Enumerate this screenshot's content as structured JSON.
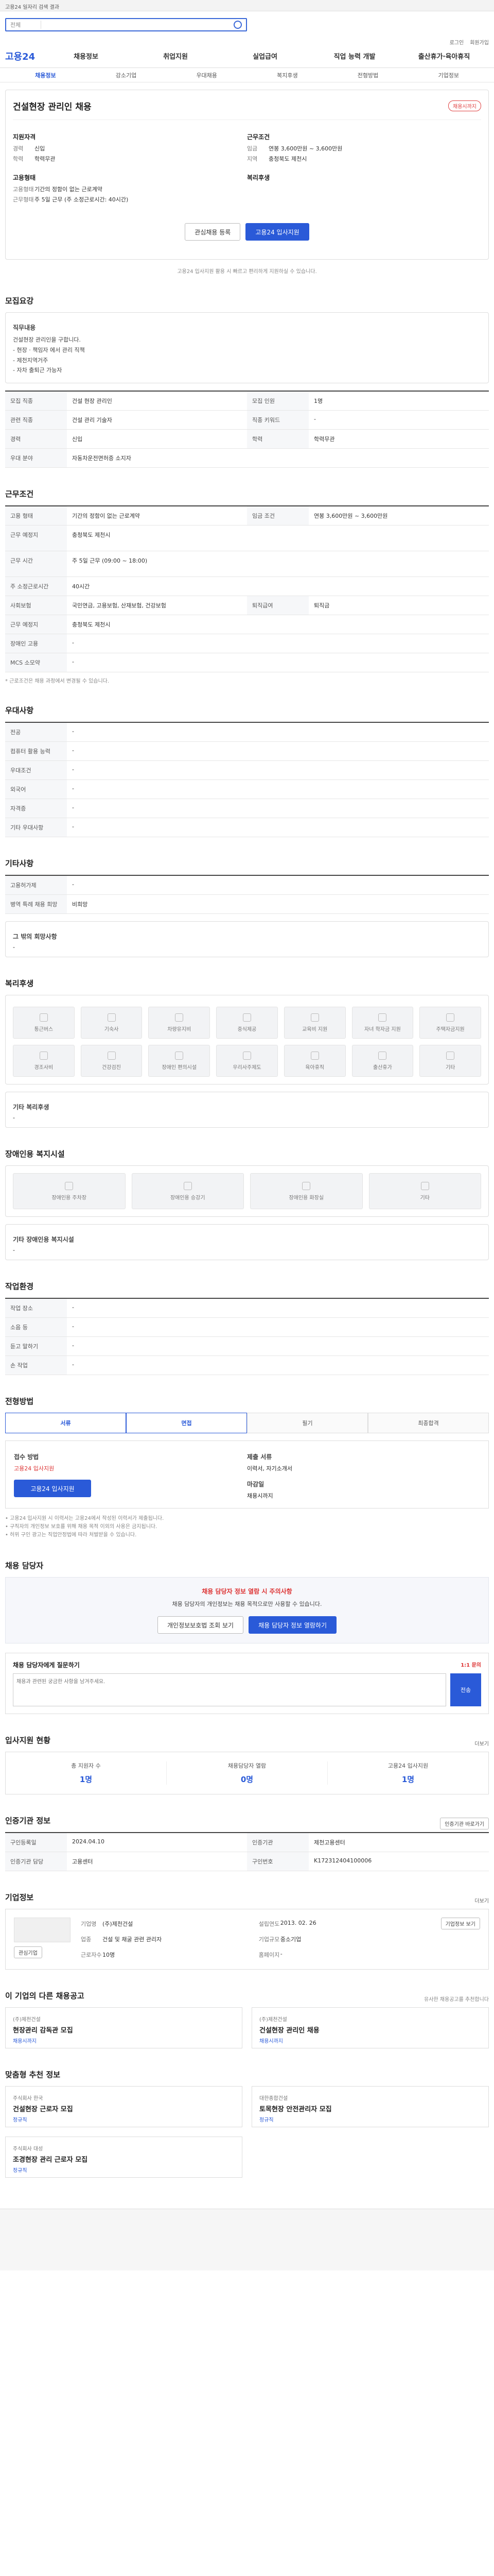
{
  "topbar": {
    "text": "고용24 일자리 검색 결과"
  },
  "search": {
    "category": "전체",
    "placeholder": ""
  },
  "util": [
    "로그인",
    "회원가입"
  ],
  "logo": "고용24",
  "gnb": [
    "채용정보",
    "취업지원",
    "실업급여",
    "직업 능력 개발",
    "출산휴가·육아휴직"
  ],
  "lnb": [
    "채용정보",
    "강소기업",
    "우대채용",
    "복지후생",
    "전형방법",
    "기업정보"
  ],
  "job": {
    "title": "건설현장 관리인 채용",
    "badge": "채용시까지",
    "left_title": "지원자격",
    "left_rows": [
      {
        "k": "경력",
        "v": "신입"
      },
      {
        "k": "학력",
        "v": "학력무관"
      }
    ],
    "left_title2": "고용형태",
    "left_rows2": [
      {
        "k": "고용형태",
        "v": "기간의 정함이 없는 근로계약"
      },
      {
        "k": "근무형태",
        "v": "주 5일 근무 (주 소정근로시간: 40시간)"
      }
    ],
    "right_title": "근무조건",
    "right_rows": [
      {
        "k": "임금",
        "v": "연봉 3,600만원 ~ 3,600만원"
      },
      {
        "k": "지역",
        "v": "충청북도 제천시"
      }
    ],
    "right_title2": "복리후생",
    "btn_scrap": "관심채용 등록",
    "btn_apply": "고용24 입사지원",
    "notice": "고용24 입사지원 활용 시 빠르고 편리하게 지원하실 수 있습니다."
  },
  "s_detail": {
    "title": "모집요강",
    "sub": "직무내용",
    "desc_lines": [
      "건설현장 관리인을 구합니다.",
      "- 현장 · 책임자 에서 관리 직책",
      "- 제천지역거주",
      "- 자차 출퇴근 가능자"
    ],
    "rows": [
      {
        "th": "모집 직종",
        "td": "건설 현장 관리인"
      },
      {
        "th": "모집 인원",
        "td": "1명"
      },
      {
        "th": "관련 직종",
        "td": "건설 관리 기술자"
      },
      {
        "th": "직종 키워드",
        "td": "-"
      },
      {
        "th": "경력",
        "td": "신입"
      },
      {
        "th": "학력",
        "td": "학력무관"
      },
      {
        "th": "우대 분야",
        "td": "자동차운전면허증 소지자"
      }
    ]
  },
  "s_cond": {
    "title": "근무조건",
    "rows": [
      {
        "th": "고용 형태",
        "td": "기간의 정함이 없는 근로계약"
      },
      {
        "th": "임금 조건",
        "td": "연봉 3,600만원 ~ 3,600만원"
      },
      {
        "th": "근무 예정지",
        "td": "충청북도 제천시"
      },
      {
        "th": "근무 시간",
        "td": "주 5일 근무 (09:00 ~ 18:00)"
      },
      {
        "th": "주 소정근로시간",
        "td": "40시간"
      },
      {
        "th": "사회보험",
        "td": "국민연금, 고용보험, 산재보험, 건강보험"
      },
      {
        "th": "퇴직급여",
        "td": "퇴직금"
      },
      {
        "th": "근무 예정지",
        "td": "충청북도 제천시"
      },
      {
        "th": "장애인 고용",
        "td": "-"
      },
      {
        "th": "MCS 소모약",
        "td": "-"
      }
    ],
    "note": "* 근로조건은 채용 과정에서 변경될 수 있습니다."
  },
  "s_pref": {
    "title": "우대사항",
    "rows": [
      {
        "th": "전공",
        "td": "-"
      },
      {
        "th": "컴퓨터 활용 능력",
        "td": "-"
      },
      {
        "th": "우대조건",
        "td": "-"
      },
      {
        "th": "외국어",
        "td": "-"
      },
      {
        "th": "자격증",
        "td": "-"
      },
      {
        "th": "기타 우대사항",
        "td": "-"
      }
    ]
  },
  "s_etc": {
    "title": "기타사항",
    "rows": [
      {
        "th": "고용허가제",
        "td": "-"
      },
      {
        "th": "병역 특례 채용 희망",
        "td": "비희망"
      }
    ],
    "sub": "그 밖의 회망사항",
    "sub_val": "-"
  },
  "s_welfare": {
    "title": "복리후생",
    "items": [
      "통근버스",
      "기숙사",
      "차량유지비",
      "중식제공",
      "교육비 지원",
      "자녀 학자금 지원",
      "주택자금지원",
      "경조사비",
      "건강검진",
      "장애인 편의시설",
      "우리사주제도",
      "육아휴직",
      "출산휴가",
      "기타"
    ],
    "sub": "기타 복리후생",
    "sub_val": "-"
  },
  "s_disabled": {
    "title": "장애인용 복지시설",
    "items": [
      "장애인용 주차장",
      "장애인용 승강기",
      "장애인용 화장실",
      "기타"
    ],
    "sub": "기타 장애인용 복지시설",
    "sub_val": "-"
  },
  "s_work": {
    "title": "작업환경",
    "rows": [
      {
        "th": "작업 장소",
        "td": "-"
      },
      {
        "th": "소음 등",
        "td": "-"
      },
      {
        "th": "듣고 말하기",
        "td": "-"
      },
      {
        "th": "손 작업",
        "td": "-"
      }
    ]
  },
  "s_process": {
    "title": "전형방법",
    "steps": [
      "서류",
      "면접",
      "필기",
      "최종합격"
    ],
    "apply_title": "접수 방법",
    "apply_val": "고용24 입사지원",
    "apply_btn": "고용24 입사지원",
    "docs_title": "제출 서류",
    "docs_val": "이력서, 자기소개서",
    "date_title": "마감일",
    "date_val": "채용시까지",
    "warn": [
      "고용24 입사지원 시 이력서는 고용24에서 작성된 이력서가 제출됩니다.",
      "구직자의 개인정보 보호를 위해 채용 목적 이외의 사용은 금지됩니다.",
      "허위 구인 광고는 직업안정법에 따라 처벌받을 수 있습니다."
    ]
  },
  "s_contact": {
    "title": "채용 담당자",
    "alert_hd": "채용 담당자 정보 열람 시 주의사항",
    "alert_body": "채용 담당자의 개인정보는 채용 목적으로만 사용할 수 있습니다.",
    "btn_agree": "개인정보보호법 조회 보기",
    "btn_view": "채용 담당자 정보 열람하기",
    "qa_title": "채용 담당자에게 질문하기",
    "qa_note": "1:1 문의",
    "qa_placeholder": "채용과 관련된 궁금한 사항을 남겨주세요.",
    "qa_send": "전송"
  },
  "s_stats": {
    "title": "입사지원 현황",
    "link": "더보기",
    "items": [
      {
        "label": "총 지원자 수",
        "num": "1명"
      },
      {
        "label": "채용담당자 열람",
        "num": "0명"
      },
      {
        "label": "고용24 입사지원",
        "num": "1명"
      }
    ]
  },
  "s_info": {
    "title": "인증기관 정보",
    "btn": "인증기관 바로가기",
    "rows": [
      {
        "th": "구인등록일",
        "td": "2024.04.10"
      },
      {
        "th": "인증기관",
        "td": "제천고용센터"
      },
      {
        "th": "인증기관 담당",
        "td": "고용센터"
      },
      {
        "th": "구인번호",
        "td": "K172312404100006"
      }
    ]
  },
  "s_company": {
    "title": "기업정보",
    "link": "더보기",
    "btn_follow": "관심기업",
    "btn_page": "기업정보 보기",
    "rows": [
      {
        "k": "기업명",
        "v": "(주)제천건설"
      },
      {
        "k": "설립연도",
        "v": "2013. 02. 26"
      },
      {
        "k": "업종",
        "v": "건설 및 채굴 관련 관리자"
      },
      {
        "k": "기업규모",
        "v": "중소기업"
      },
      {
        "k": "근로자수",
        "v": "10명"
      },
      {
        "k": "홈페이지",
        "v": "-"
      }
    ]
  },
  "s_similar": {
    "title": "이 기업의 다른 채용공고",
    "notice": "유사한 채용공고를 추천합니다",
    "jobs": [
      {
        "co": "(주)제천건설",
        "title": "현장관리 감독관 모집",
        "tag": "채용시까지"
      },
      {
        "co": "(주)제천건설",
        "title": "건설현장 관리인 채용",
        "tag": "채용시까지"
      }
    ]
  },
  "s_reco": {
    "title": "맞춤형 추천 정보",
    "jobs": [
      {
        "co": "주식회사 한국",
        "title": "건설현장 근로자 모집",
        "tag": "정규직"
      },
      {
        "co": "대한종합건설",
        "title": "토목현장 안전관리자 모집",
        "tag": "정규직"
      },
      {
        "co": "주식회사 대성",
        "title": "조경현장 관리 근로자 모집",
        "tag": "정규직"
      }
    ]
  },
  "colors": {
    "accent": "#2a5ad8",
    "warn": "#e04141"
  }
}
